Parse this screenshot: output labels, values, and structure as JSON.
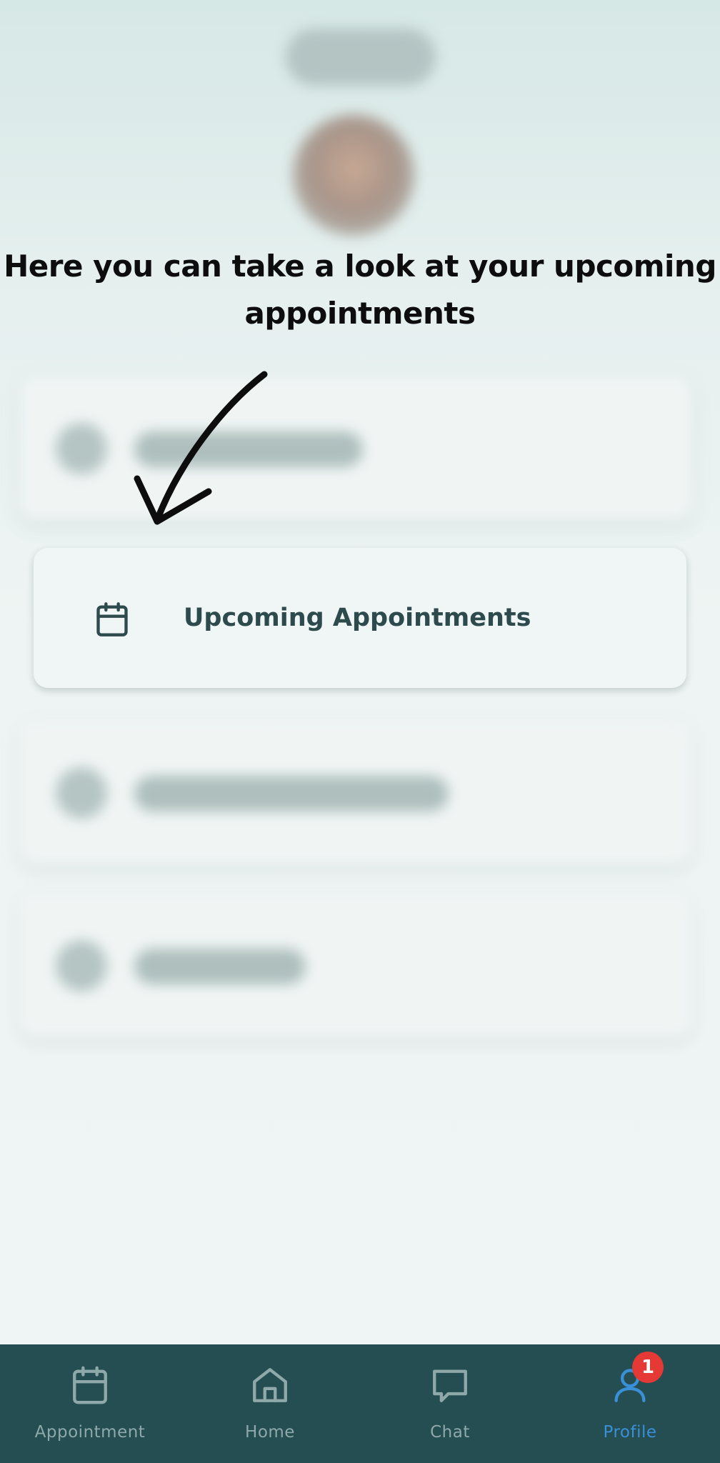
{
  "instruction": {
    "text": "Here you can take a look at your upcoming appointments"
  },
  "highlighted_item": {
    "icon": "calendar-icon",
    "label": "Upcoming Appointments"
  },
  "bottom_nav": {
    "items": [
      {
        "label": "Appointment",
        "icon": "calendar-icon",
        "active": false
      },
      {
        "label": "Home",
        "icon": "home-icon",
        "active": false
      },
      {
        "label": "Chat",
        "icon": "chat-icon",
        "active": false
      },
      {
        "label": "Profile",
        "icon": "user-icon",
        "active": true,
        "badge": "1"
      }
    ]
  },
  "colors": {
    "nav_background": "#244e52",
    "nav_inactive": "#8fa8a9",
    "nav_active": "#3a8fd6",
    "badge": "#e53935",
    "card_text": "#2d4a4d",
    "instruction_text": "#0d0d0d"
  }
}
